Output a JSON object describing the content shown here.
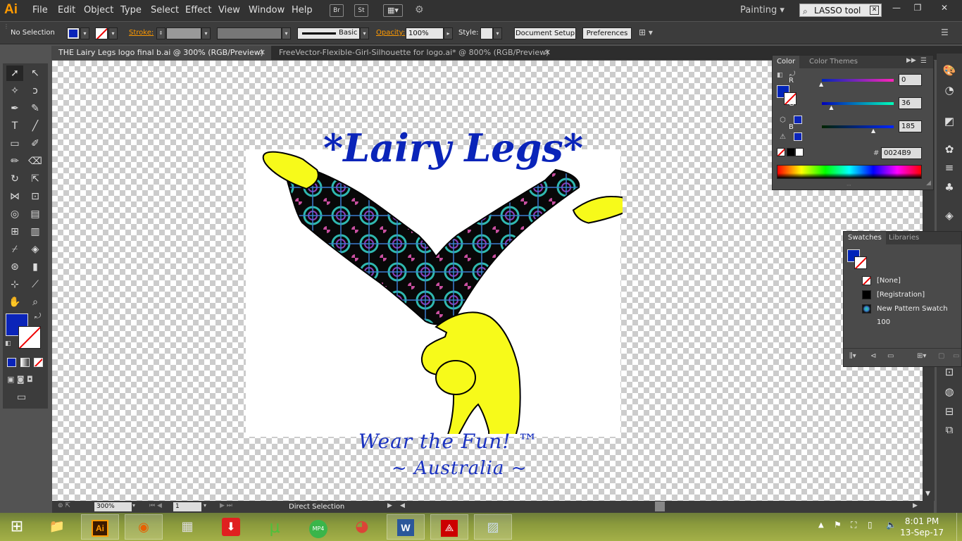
{
  "app": {
    "logo": "Ai"
  },
  "menu": [
    "File",
    "Edit",
    "Object",
    "Type",
    "Select",
    "Effect",
    "View",
    "Window",
    "Help"
  ],
  "menu_buttons": {
    "br": "Br",
    "st": "St"
  },
  "workspace": "Painting",
  "search": {
    "value": "LASSO tool"
  },
  "window_controls": {
    "minimize": "—",
    "restore": "❐",
    "close": "✕"
  },
  "controlbar": {
    "selection": "No Selection",
    "stroke_label": "Stroke:",
    "brush": "Basic",
    "opacity_label": "Opacity:",
    "opacity": "100%",
    "style_label": "Style:",
    "document_setup": "Document Setup",
    "preferences": "Preferences"
  },
  "tabs": [
    {
      "label": "THE Lairy Legs logo final b.ai @ 300% (RGB/Preview)",
      "active": true
    },
    {
      "label": "FreeVector-Flexible-Girl-Silhouette for logo.ai* @ 800% (RGB/Preview)",
      "active": false
    }
  ],
  "artwork": {
    "title": "*Lairy Legs*",
    "tagline": "Wear the Fun! ™",
    "location": "~ Australia ~"
  },
  "color_panel": {
    "tabs": [
      "Color",
      "Color Themes"
    ],
    "r_label": "R",
    "g_label": "G",
    "b_label": "B",
    "r": "0",
    "g": "36",
    "b": "185",
    "r_frac": 0.0,
    "g_frac": 0.141,
    "b_frac": 0.725,
    "hex_label": "#",
    "hex": "0024B9",
    "fill_color": "#0024b9"
  },
  "swatches_panel": {
    "tabs": [
      "Swatches",
      "Libraries"
    ],
    "items": [
      "[None]",
      "[Registration]",
      "New Pattern Swatch 100"
    ]
  },
  "status": {
    "zoom": "300%",
    "artboard": "1",
    "tool": "Direct Selection"
  },
  "clock": {
    "time": "8:01 PM",
    "date": "13-Sep-17"
  },
  "colors": {
    "accent": "#ff9a00",
    "brand_blue": "#0a24b9",
    "figure_yellow": "#f7fa1a"
  }
}
